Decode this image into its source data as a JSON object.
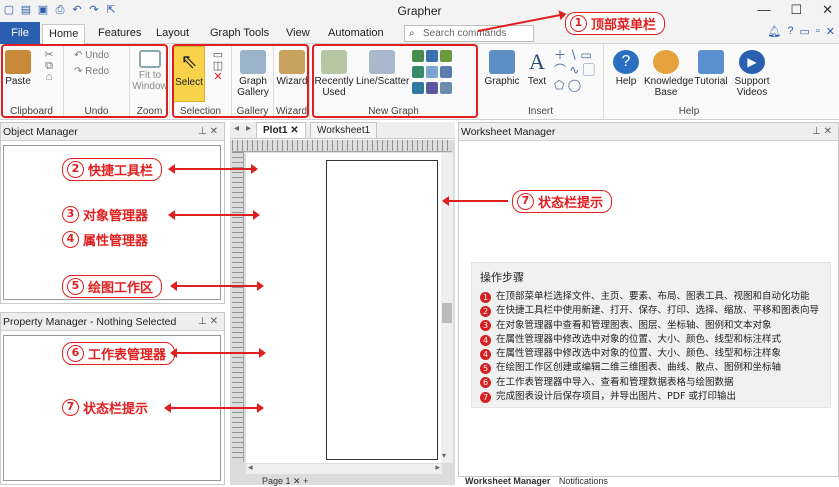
{
  "app_title": "Grapher",
  "window_controls": [
    "—",
    "☐",
    "✕"
  ],
  "menu_tabs": [
    {
      "label": "File"
    },
    {
      "label": "Home"
    },
    {
      "label": "Features"
    },
    {
      "label": "Layout"
    },
    {
      "label": "Graph Tools"
    },
    {
      "label": "View"
    },
    {
      "label": "Automation"
    }
  ],
  "search": {
    "placeholder": "Search commands"
  },
  "ribbon": {
    "clipboard": {
      "paste": "Paste",
      "group": "Clipboard"
    },
    "undo": {
      "undo": "Undo",
      "redo": "Redo",
      "group": "Undo"
    },
    "zoom": {
      "fit": "Fit to Window",
      "group": "Zoom"
    },
    "selection": {
      "select": "Select",
      "group": "Selection"
    },
    "gallery": {
      "graph_gallery": "Graph Gallery",
      "group": "Gallery"
    },
    "wizard": {
      "wizard": "Wizard",
      "group": "Wizard"
    },
    "new_graph": {
      "recent": "Recently Used",
      "line_scatter": "Line/Scatter",
      "group": "New Graph"
    },
    "insert": {
      "graphic": "Graphic",
      "text": "Text",
      "group": "Insert"
    },
    "help": {
      "help": "Help",
      "kb": "Knowledge Base",
      "tutorial": "Tutorial",
      "support": "Support Videos",
      "group": "Help"
    }
  },
  "panels": {
    "object_manager": "Object Manager",
    "property_manager": "Property Manager - Nothing Selected",
    "worksheet_manager": "Worksheet Manager"
  },
  "doc_tabs": [
    "Plot1",
    "Worksheet1"
  ],
  "bottom_tabs": {
    "page": "Page 1",
    "ws_manager": "Worksheet Manager",
    "notifications": "Notifications"
  },
  "callouts": {
    "c1": {
      "num": "1",
      "text": "顶部菜单栏"
    },
    "c2": {
      "num": "2",
      "text": "快捷工具栏"
    },
    "c3": {
      "num": "3",
      "text": "对象管理器"
    },
    "c4": {
      "num": "4",
      "text": "属性管理器"
    },
    "c5": {
      "num": "5",
      "text": "绘图工作区"
    },
    "c6": {
      "num": "6",
      "text": "工作表管理器"
    },
    "c7a": {
      "num": "7",
      "text": "状态栏提示"
    },
    "c7b": {
      "num": "7",
      "text": "状态栏提示"
    }
  },
  "steps": {
    "title": "操作步骤",
    "items": [
      {
        "num": "1",
        "text": "在顶部菜单栏选择文件、主页、要素、布局、图表工具、视图和自动化功能"
      },
      {
        "num": "2",
        "text": "在快捷工具栏中使用新建、打开、保存、打印、选择、缩放、平移和图表向导"
      },
      {
        "num": "3",
        "text": "在对象管理器中查看和管理图表、图层、坐标轴、图例和文本对象"
      },
      {
        "num": "4",
        "text": "在属性管理器中修改选中对象的位置、大小、颜色、线型和标注样式"
      },
      {
        "num": "4",
        "text": "在属性管理器中修改选中对象的位置、大小、颜色、线型和标注样象"
      },
      {
        "num": "5",
        "text": "在绘图工作区创建或编辑二维三维图表、曲线、散点、图例和坐标轴"
      },
      {
        "num": "6",
        "text": "在工作表管理器中导入、查看和管理数据表格与绘图数据"
      },
      {
        "num": "7",
        "text": "完成图表设计后保存项目，并导出图片、PDF 或打印输出"
      }
    ]
  },
  "colors": {
    "accent_red": "#e02020",
    "file_blue": "#2a5fb0"
  }
}
